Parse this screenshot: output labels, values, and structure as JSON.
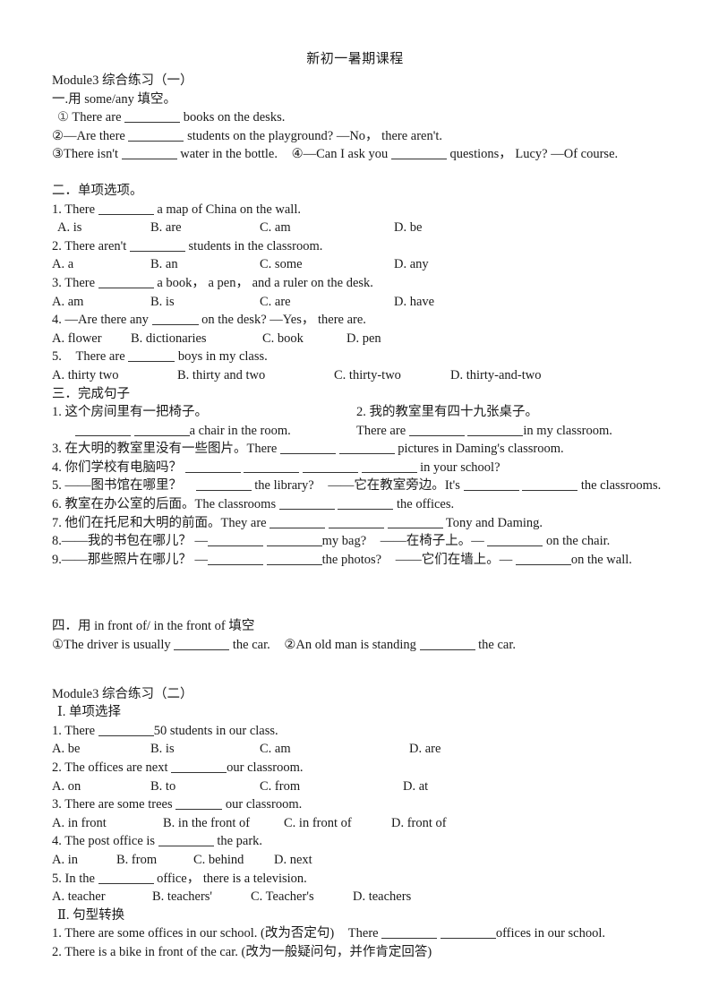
{
  "document": {
    "title": "新初一暑期课程"
  },
  "module1": {
    "heading": "Module3 综合练习（一）",
    "section1": {
      "heading": "一.用 some/any 填空。",
      "items": [
        {
          "marker": "①",
          "pre": "There are",
          "mid": "books on the desks.",
          "post": ""
        },
        {
          "marker": "②",
          "pre": "—Are there",
          "mid": "students on the playground? —No，",
          "post": "there aren't."
        },
        {
          "marker": "③",
          "pre": "There isn't",
          "mid": "water in the bottle.",
          "post": ""
        }
      ],
      "line3_tail_marker": "④",
      "line3_tail_pre": "—Can I ask you",
      "line3_tail_mid": "questions，",
      "line3_tail_post": "Lucy? —Of course."
    },
    "section2": {
      "heading": "二．单项选项。",
      "questions": [
        {
          "num": "1.",
          "stem_pre": "There",
          "stem_post": "a map of China on the wall.",
          "options": [
            "A. is",
            "B. are",
            "C. am",
            "D. be"
          ]
        },
        {
          "num": "2.",
          "stem_pre": "There aren't",
          "stem_post": "students in the classroom.",
          "options": [
            "A. a",
            "B. an",
            "C. some",
            "D. any"
          ]
        },
        {
          "num": "3.",
          "stem_pre": "There",
          "stem_post": "a book，  a pen，  and a ruler on the desk.",
          "options": [
            "A. am",
            "B. is",
            "C. are",
            "D. have"
          ]
        },
        {
          "num": "4.",
          "stem_pre": "—Are there any",
          "stem_post": "on the desk? —Yes，  there are.",
          "options": [
            "A. flower",
            "B. dictionaries",
            "C. book",
            "D. pen"
          ]
        },
        {
          "num": "5.",
          "stem_pre": "There are",
          "stem_post": "boys in my class.",
          "options": [
            "A. thirty two",
            "B. thirty and two",
            "C. thirty-two",
            "D. thirty-and-two"
          ]
        }
      ]
    },
    "section3": {
      "heading": "三．完成句子",
      "q1_left_cn": "1. 这个房间里有一把椅子。",
      "q2_right_cn": "2. 我的教室里有四十九张桌子。",
      "q1_left_en_post": "a chair in the room.",
      "q2_right_en_pre": "There are",
      "q2_right_en_post": "in my classroom.",
      "q3_cn": "3. 在大明的教室里没有一些图片。",
      "q3_en_pre": "There",
      "q3_en_post": "pictures in Daming's classroom.",
      "q4_cn": "4. 你们学校有电脑吗？",
      "q4_en_post": "in your school?",
      "q5_cn": "5. ——图书馆在哪里？",
      "q5_mid": "the library?",
      "q5_cn2": "——它在教室旁边。",
      "q5_en_pre": "It's",
      "q5_en_post": "the classrooms.",
      "q6_cn": "6. 教室在办公室的后面。",
      "q6_en_pre": "The classrooms",
      "q6_en_post": "the offices.",
      "q7_cn": "7. 他们在托尼和大明的前面。",
      "q7_en_pre": "They are",
      "q7_en_post": "Tony and Daming.",
      "q8_cn": "8.——我的书包在哪儿？",
      "q8_dash": "—",
      "q8_mid": "my bag?",
      "q8_cn2": "——在椅子上。",
      "q8_dash2": "—",
      "q8_post": "on the chair.",
      "q9_cn": "9.——那些照片在哪儿？",
      "q9_dash": "—",
      "q9_mid": "the photos?",
      "q9_cn2": "——它们在墙上。",
      "q9_dash2": "—",
      "q9_post": "on the wall."
    },
    "section4": {
      "heading": "四．用 in front of/ in the front of 填空",
      "item1_marker": "①",
      "item1_pre": "The driver is usually",
      "item1_post": "the car.",
      "item2_marker": "②",
      "item2_pre": "An old man is standing",
      "item2_post": "the car."
    }
  },
  "module2": {
    "heading": "Module3 综合练习（二）",
    "section1": {
      "heading": "Ⅰ. 单项选择",
      "questions": [
        {
          "num": "1.",
          "stem_pre": "There",
          "stem_post": "50 students in our class.",
          "options": [
            "A. be",
            "B. is",
            "C. am",
            "D. are"
          ]
        },
        {
          "num": "2.",
          "stem_pre": "The offices are next",
          "stem_post": "our classroom.",
          "options": [
            "A. on",
            "B. to",
            "C. from",
            "D. at"
          ]
        },
        {
          "num": "3.",
          "stem_pre": "There are some trees",
          "stem_post": "our classroom.",
          "options": [
            "A. in front",
            "B. in the front of",
            "C. in front of",
            "D. front of"
          ]
        },
        {
          "num": "4.",
          "stem_pre": "The post office is",
          "stem_post": "the park.",
          "options": [
            "A. in",
            "B. from",
            "C. behind",
            "D. next"
          ]
        },
        {
          "num": "5.",
          "stem_pre": "In the",
          "stem_post": "office，  there is a television.",
          "options": [
            "A. teacher",
            "B. teachers'",
            "C. Teacher's",
            "D. teachers"
          ]
        }
      ]
    },
    "section2": {
      "heading": "Ⅱ. 句型转换",
      "q1_pre": "1. There are some offices in our school. (改为否定句)",
      "q1_mid": "There",
      "q1_post": "offices in our school.",
      "q2": "2. There is a bike in front of the car. (改为一般疑问句，并作肯定回答)"
    }
  }
}
